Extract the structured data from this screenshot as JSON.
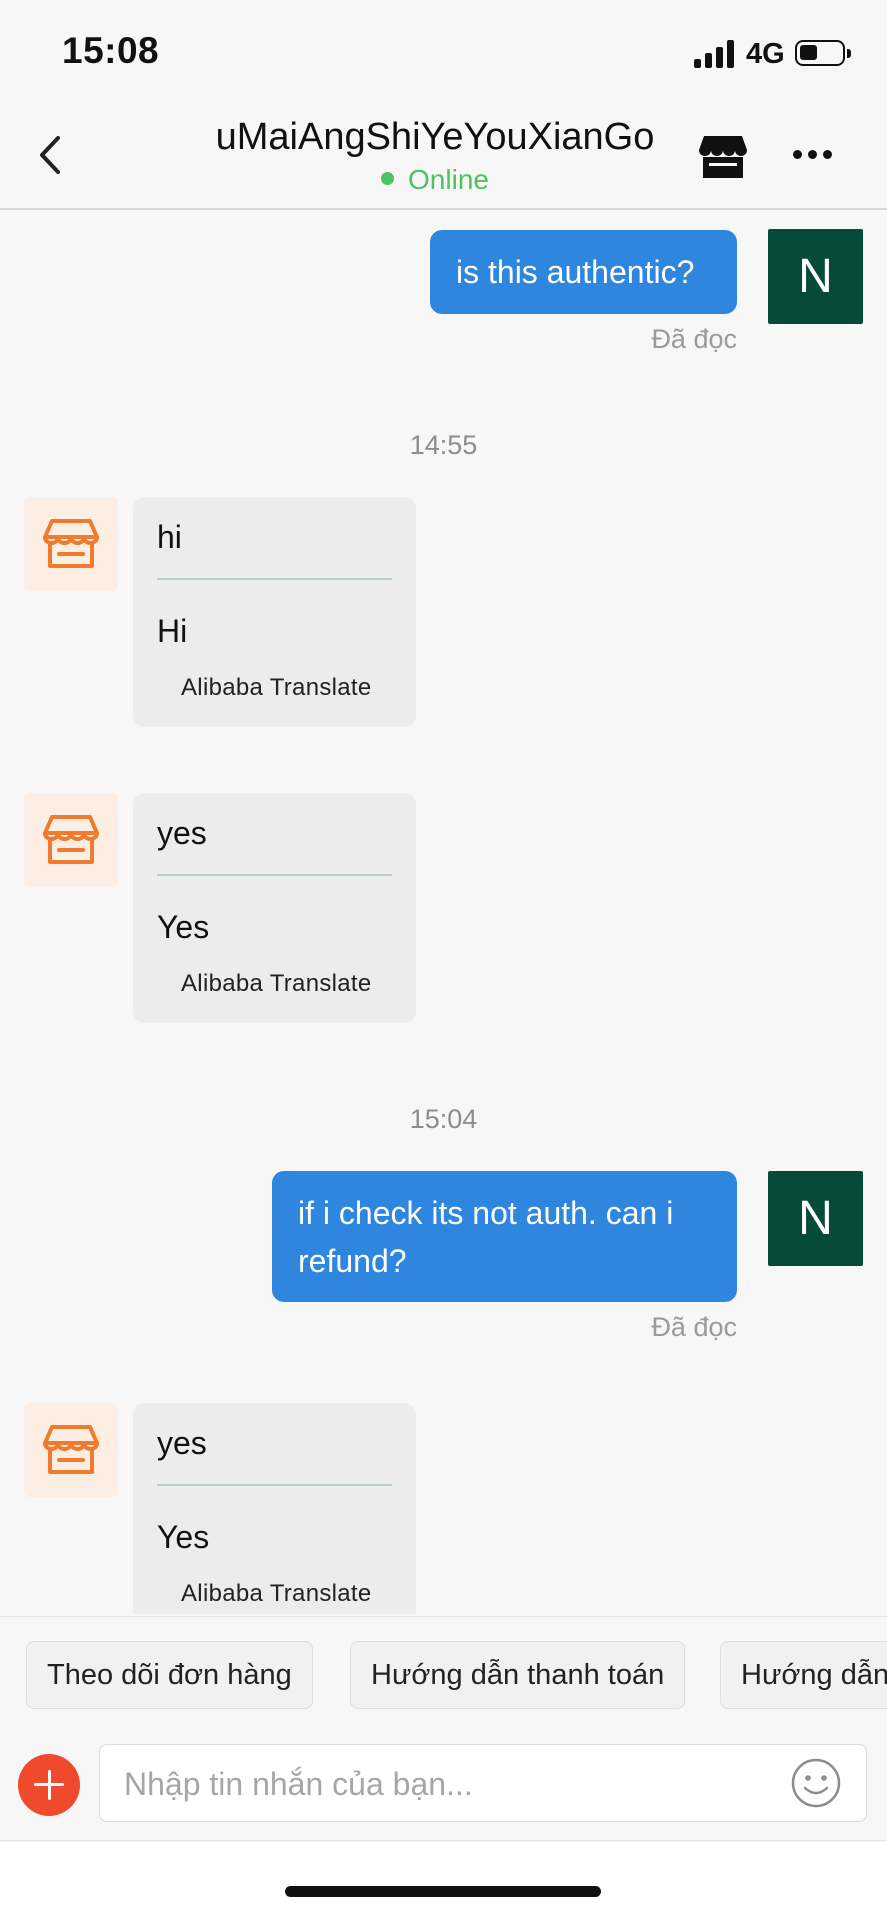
{
  "status_bar": {
    "time": "15:08",
    "network": "4G"
  },
  "header": {
    "back_icon": "chevron-left-icon",
    "title": "uMaiAngShiYeYouXianGo",
    "status": "Online",
    "status_color": "#4cc261",
    "store_icon": "store-icon",
    "more_icon": "more-horizontal-icon"
  },
  "messages": [
    {
      "type": "out",
      "text": "is this authentic?",
      "avatar": "N",
      "read": "Đã đọc"
    },
    {
      "type": "time",
      "text": "14:55"
    },
    {
      "type": "in",
      "original": "hi",
      "translated": "Hi",
      "translator": "Alibaba Translate"
    },
    {
      "type": "in",
      "original": "yes",
      "translated": "Yes",
      "translator": "Alibaba Translate"
    },
    {
      "type": "time",
      "text": "15:04"
    },
    {
      "type": "out",
      "text": "if i check its not auth. can i refund?",
      "avatar": "N",
      "read": "Đã đọc"
    },
    {
      "type": "in",
      "original": "yes",
      "translated": "Yes",
      "translator": "Alibaba Translate"
    }
  ],
  "quick_replies": [
    "Theo dõi đơn hàng",
    "Hướng dẫn thanh toán",
    "Hướng dẫn"
  ],
  "composer": {
    "placeholder": "Nhập tin nhắn của bạn...",
    "value": ""
  },
  "colors": {
    "outgoing_bubble": "#2e86de",
    "avatar_bg": "#064a3a",
    "shop_icon": "#f07a2e",
    "plus_button": "#f04a2c"
  }
}
